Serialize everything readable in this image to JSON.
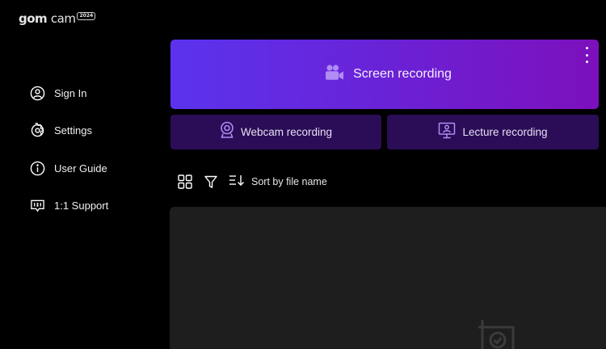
{
  "app": {
    "logo_main": "gom",
    "logo_sub": "cam",
    "logo_badge": "2024"
  },
  "sidebar": {
    "items": [
      {
        "label": "Sign In",
        "icon": "user-circle-icon"
      },
      {
        "label": "Settings",
        "icon": "gear-icon"
      },
      {
        "label": "User Guide",
        "icon": "info-icon"
      },
      {
        "label": "1:1 Support",
        "icon": "support-chat-icon"
      }
    ]
  },
  "recording": {
    "screen_label": "Screen recording",
    "screen_icon": "video-camera-icon",
    "webcam_label": "Webcam recording",
    "webcam_icon": "webcam-icon",
    "lecture_label": "Lecture recording",
    "lecture_icon": "lecture-icon"
  },
  "toolbar": {
    "sort_label": "Sort by file name"
  },
  "colors": {
    "background": "#000000",
    "primary_gradient_start": "#5b33ee",
    "primary_gradient_end": "#7c10bc",
    "secondary_card": "#2b0c57",
    "icon_accent": "#b08cf5",
    "file_area": "#1e1e1e"
  }
}
